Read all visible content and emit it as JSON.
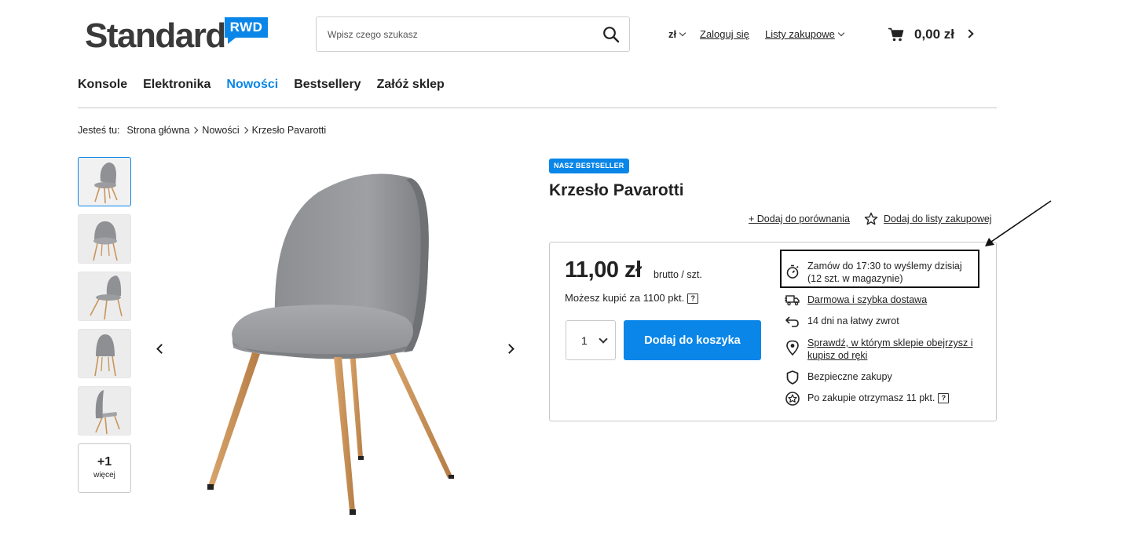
{
  "header": {
    "logo_text": "Standard",
    "logo_badge": "RWD",
    "search_placeholder": "Wpisz czego szukasz",
    "currency": "zł",
    "login": "Zaloguj się",
    "shopping_lists": "Listy zakupowe",
    "cart_total": "0,00 zł"
  },
  "nav": {
    "items": [
      "Konsole",
      "Elektronika",
      "Nowości",
      "Bestsellery",
      "Załóż sklep"
    ],
    "active": "Nowości"
  },
  "breadcrumb": {
    "label": "Jesteś tu:",
    "items": [
      "Strona główna",
      "Nowości",
      "Krzesło Pavarotti"
    ]
  },
  "gallery": {
    "more_count": "+1",
    "more_label": "więcej"
  },
  "product": {
    "badge": "NASZ BESTSELLER",
    "title": "Krzesło Pavarotti",
    "compare": "+ Dodaj do porównania",
    "wishlist": "Dodaj do listy zakupowej",
    "price": "11,00 zł",
    "price_unit": "brutto / szt.",
    "points_text": "Możesz kupić za 1100 pkt.",
    "help_glyph": "?",
    "quantity": "1",
    "add_to_cart": "Dodaj do koszyka"
  },
  "info": {
    "shipping_line1": "Zamów do 17:30 to wyślemy dzisiaj",
    "shipping_line2": "(12 szt. w magazynie)",
    "delivery": "Darmowa i szybka dostawa",
    "returns": "14 dni na łatwy zwrot",
    "stores_line1": "Sprawdź, w którym sklepie obejrzysz i",
    "stores_line2": "kupisz od ręki",
    "secure": "Bezpieczne zakupy",
    "reward": "Po zakupie otrzymasz 11 pkt."
  },
  "colors": {
    "accent": "#0a86e8",
    "text": "#222222",
    "border": "#c8c8c8"
  }
}
